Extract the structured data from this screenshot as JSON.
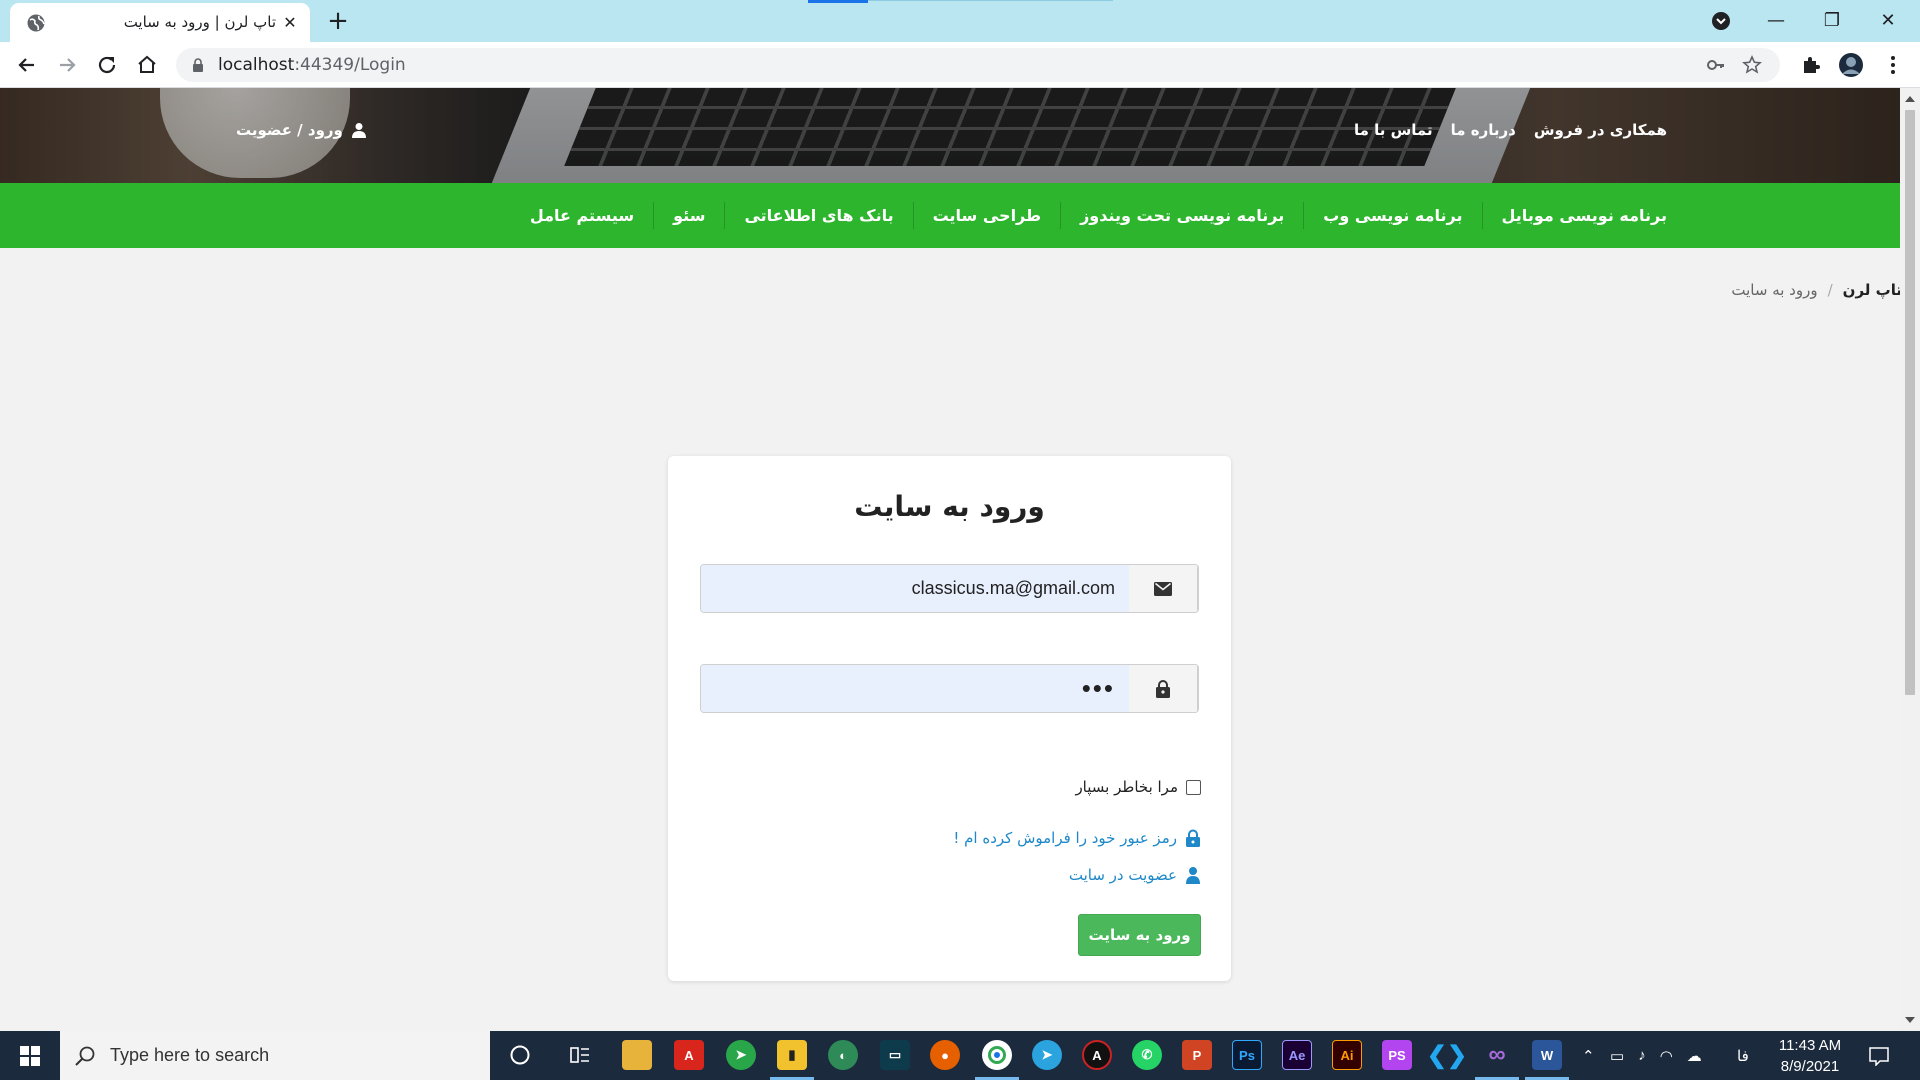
{
  "browser": {
    "tab_title": "تاپ لرن | ورود به سایت",
    "url_host": "localhost",
    "url_rest": ":44349/Login"
  },
  "header": {
    "top_links": [
      "همکاری در فروش",
      "درباره ما",
      "تماس با ما"
    ],
    "login_label": "ورود / عضویت"
  },
  "nav": {
    "items": [
      "برنامه نویسی موبایل",
      "برنامه نویسی وب",
      "برنامه نویسی تحت ویندوز",
      "طراحی سایت",
      "بانک های اطلاعاتی",
      "سئو",
      "سیستم عامل"
    ]
  },
  "breadcrumb": {
    "home": "تاپ لرن",
    "separator": "/",
    "current": "ورود به سایت"
  },
  "login": {
    "title": "ورود به سایت",
    "email_value": "classicus.ma@gmail.com",
    "password_value": "•••",
    "remember_label": "مرا بخاطر بسپار",
    "forgot_label": "رمز عبور خود را فراموش کرده ام !",
    "register_label": "عضویت در سایت",
    "submit_label": "ورود به سایت"
  },
  "taskbar": {
    "search_placeholder": "Type here to search",
    "lang": "فا",
    "time": "11:43 AM",
    "date": "8/9/2021"
  },
  "colors": {
    "nav_green": "#2db52d",
    "button_green": "#4cb85c",
    "link_blue": "#1e88c8",
    "input_autofill": "#e8f0fe"
  }
}
